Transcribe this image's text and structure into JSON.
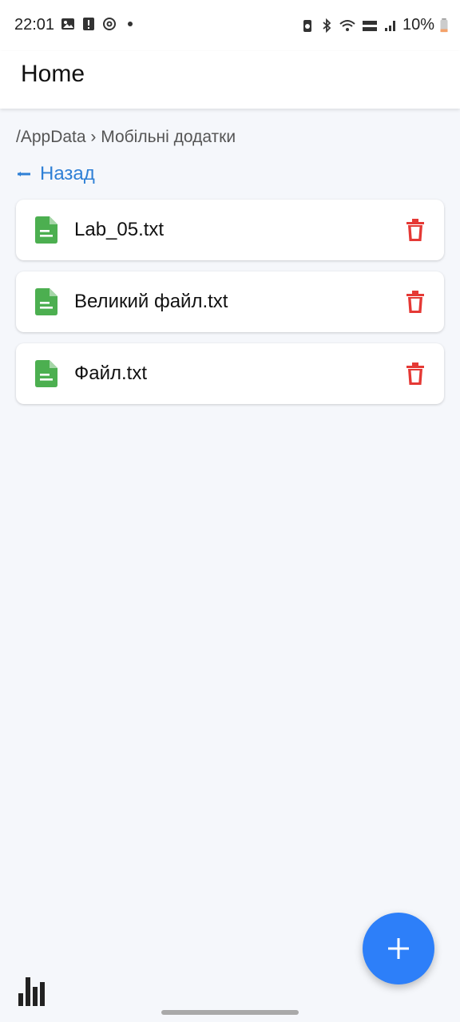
{
  "status_bar": {
    "time": "22:01",
    "battery_percent": "10%",
    "left_icons": [
      "image-icon",
      "alert-icon",
      "threads-icon",
      "dot-icon"
    ],
    "right_icons": [
      "battery-saver-icon",
      "bluetooth-icon",
      "wifi-icon",
      "vowifi-icon",
      "signal-icon",
      "battery-icon"
    ]
  },
  "app_bar": {
    "title": "Home"
  },
  "breadcrumb": {
    "text": "/AppData › Мобільні додатки"
  },
  "back": {
    "label": "Назад",
    "icon": "arrow-left-icon"
  },
  "files": [
    {
      "name": "Lab_05.txt"
    },
    {
      "name": "Великий файл.txt"
    },
    {
      "name": "Файл.txt"
    }
  ],
  "colors": {
    "accent": "#2f80d6",
    "fab": "#2d7ff9",
    "file_icon": "#4caf50",
    "delete_icon": "#e53935",
    "background": "#f5f7fb"
  },
  "fab": {
    "icon": "plus-icon"
  },
  "bottom": {
    "stats_icon": "bar-chart-icon"
  }
}
